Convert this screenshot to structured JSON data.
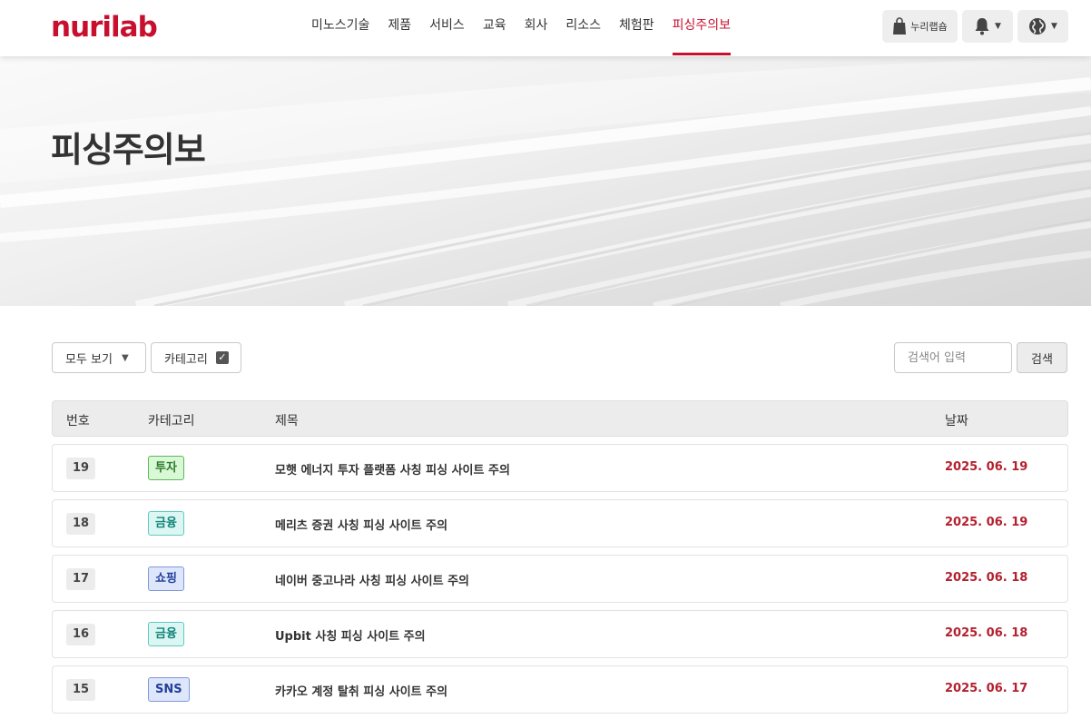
{
  "header": {
    "logo": "nurilab",
    "nav": [
      "미노스기술",
      "제품",
      "서비스",
      "교육",
      "회사",
      "리소스",
      "체험판",
      "피싱주의보"
    ],
    "active_nav": 7,
    "shop_label": "누리랩숍",
    "shop_icon": "shopping-bag-icon",
    "bell_icon": "bell-icon",
    "globe_icon": "globe-icon"
  },
  "banner": {
    "title": "피싱주의보"
  },
  "controls": {
    "filter_label": "모두 보기",
    "category_label": "카테고리",
    "search_placeholder": "검색어 입력",
    "search_button": "검색"
  },
  "table": {
    "headers": [
      "번호",
      "카테고리",
      "제목",
      "날짜"
    ],
    "rows": [
      {
        "num": "19",
        "category": "투자",
        "category_color": "#d9f8d5",
        "title": "모햇 에너지 투자 플랫폼 사칭 피싱 사이트 주의",
        "date": "2025. 06. 19"
      },
      {
        "num": "18",
        "category": "금융",
        "category_color": "#dcf7f3",
        "title": "메리츠 증권 사칭 피싱 사이트 주의",
        "date": "2025. 06. 19"
      },
      {
        "num": "17",
        "category": "쇼핑",
        "category_color": "#dde6fb",
        "title": "네이버 중고나라 사칭 피싱 사이트 주의",
        "date": "2025. 06. 18"
      },
      {
        "num": "16",
        "category": "금융",
        "category_color": "#dcf7f3",
        "title": "Upbit 사칭 피싱 사이트 주의",
        "date": "2025. 06. 18"
      },
      {
        "num": "15",
        "category": "SNS",
        "category_color": "#dde6fb",
        "title": "카카오 계정 탈취 피싱 사이트 주의",
        "date": "2025. 06. 17"
      }
    ]
  },
  "colors": {
    "accent": "#c8102e",
    "date": "#b3202e"
  }
}
